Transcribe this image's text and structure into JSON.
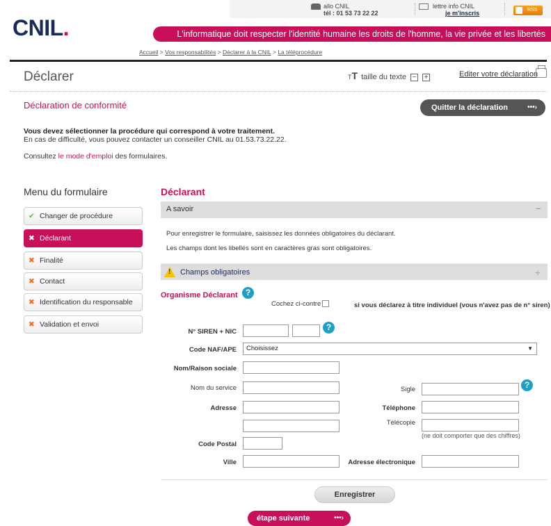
{
  "header": {
    "logo": "CNIL",
    "logo_dot": ".",
    "allo_title": "allo CNIL",
    "allo_phone": "tél : 01 53 73 22 22",
    "lettre_title": "lettre info CNIL",
    "lettre_link": "je m'inscris",
    "rss_label": "RSS",
    "slogan": "L'informatique doit respecter l'identité humaine les droits de l'homme, la vie privée et les libertés",
    "breadcrumb": [
      "Accueil",
      "Vos responsabilités",
      "Déclarer à la CNIL",
      "La téléprocédure"
    ],
    "breadcrumb_sep": " > "
  },
  "titlebar": {
    "title": "Déclarer",
    "text_size_label": "taille du texte",
    "minus": "−",
    "plus": "+",
    "edit_link": "Editer votre déclaration"
  },
  "declaration": {
    "title": "Déclaration de conformité",
    "quit_button": "Quitter la déclaration",
    "arrow": "•••›",
    "intro_bold": "Vous devez sélectionner la procédure qui correspond à votre traitement.",
    "intro_line2": "En cas de difficulté, vous pouvez contacter un conseiller CNIL au 01.53.73.22.22.",
    "consult_prefix": "Consultez ",
    "consult_link": "le mode d'emploi",
    "consult_suffix": " des formulaires."
  },
  "menu": {
    "title": "Menu du formulaire",
    "items": [
      {
        "label": "Changer de procédure",
        "icon": "✔"
      },
      {
        "label": "Déclarant",
        "icon": "✖"
      },
      {
        "label": "Finalité",
        "icon": "✖"
      },
      {
        "label": "Contact",
        "icon": "✖"
      },
      {
        "label": "Identification du responsable",
        "icon": "✖"
      },
      {
        "label": "Validation et envoi",
        "icon": "✖"
      }
    ]
  },
  "main": {
    "section_title": "Déclarant",
    "asavoir_title": "A savoir",
    "asavoir_toggle": "−",
    "asavoir_line1": "Pour enregistrer le formulaire, saisissez les données obligatoires du déclarant.",
    "asavoir_line2": "Les champs dont les libellés sont en caractères gras sont obligatoires.",
    "champs_title": "Champs obligatoires",
    "champs_toggle": "+",
    "org_title": "Organisme Déclarant",
    "help": "?",
    "cochez": "Cochez ci-contre",
    "individuel": "si vous déclarez à titre individuel (vous n'avez pas de n° siren)",
    "form": {
      "siren_label": "N° SIREN + NIC",
      "naf_label": "Code NAF/APE",
      "naf_value": "Choisissez",
      "naf_caret": "▼",
      "nom_label": "Nom/Raison sociale",
      "service_label": "Nom du service",
      "sigle_label": "Sigle",
      "adresse_label": "Adresse",
      "telephone_label": "Téléphone",
      "telecopie_label": "Télécopie",
      "hint": "(ne doit comporter que des chiffres)",
      "cp_label": "Code Postal",
      "ville_label": "Ville",
      "email_label": "Adresse électronique"
    },
    "save_button": "Enregistrer",
    "next_button": "étape suivante",
    "next_arrow": "•••›"
  }
}
